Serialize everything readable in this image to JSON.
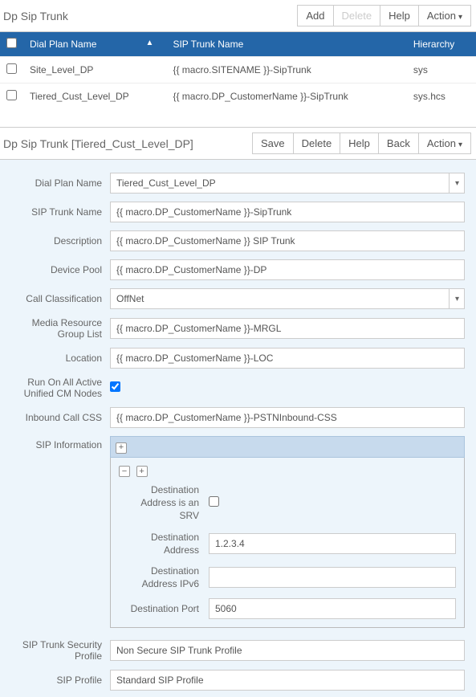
{
  "top": {
    "title": "Dp Sip Trunk",
    "buttons": {
      "add": "Add",
      "delete": "Delete",
      "help": "Help",
      "action": "Action"
    }
  },
  "grid": {
    "headers": {
      "dial": "Dial Plan Name",
      "trunk": "SIP Trunk Name",
      "hier": "Hierarchy"
    },
    "rows": [
      {
        "dial": "Site_Level_DP",
        "trunk": "{{ macro.SITENAME }}-SipTrunk",
        "hier": "sys"
      },
      {
        "dial": "Tiered_Cust_Level_DP",
        "trunk": "{{ macro.DP_CustomerName }}-SipTrunk",
        "hier": "sys.hcs"
      }
    ]
  },
  "edit": {
    "title": "Dp Sip Trunk [Tiered_Cust_Level_DP]",
    "buttons": {
      "save": "Save",
      "delete": "Delete",
      "help": "Help",
      "back": "Back",
      "action": "Action"
    }
  },
  "form": {
    "labels": {
      "dialPlan": "Dial Plan Name",
      "trunkName": "SIP Trunk Name",
      "description": "Description",
      "devicePool": "Device Pool",
      "callClass": "Call Classification",
      "mrgl": "Media Resource Group List",
      "location": "Location",
      "runAll": "Run On All Active Unified CM Nodes",
      "inboundCss": "Inbound Call CSS",
      "sipInfo": "SIP Information",
      "secProfile": "SIP Trunk Security Profile",
      "sipProfile": "SIP Profile"
    },
    "values": {
      "dialPlan": "Tiered_Cust_Level_DP",
      "trunkName": "{{ macro.DP_CustomerName }}-SipTrunk",
      "description": "{{ macro.DP_CustomerName }} SIP Trunk",
      "devicePool": "{{ macro.DP_CustomerName }}-DP",
      "callClass": "OffNet",
      "mrgl": "{{ macro.DP_CustomerName }}-MRGL",
      "location": "{{ macro.DP_CustomerName }}-LOC",
      "inboundCss": "{{ macro.DP_CustomerName }}-PSTNInbound-CSS",
      "secProfile": "Non Secure SIP Trunk Profile",
      "sipProfile": "Standard SIP Profile"
    },
    "sip": {
      "labels": {
        "isSrv": "Destination Address is an SRV",
        "addr": "Destination Address",
        "addr6": "Destination Address IPv6",
        "port": "Destination Port"
      },
      "values": {
        "addr": "1.2.3.4",
        "addr6": "",
        "port": "5060"
      }
    }
  }
}
